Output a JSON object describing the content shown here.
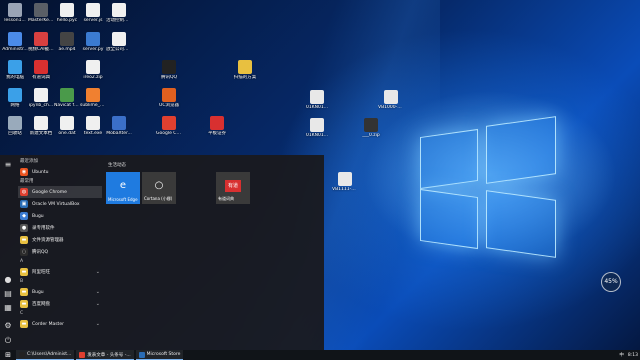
{
  "desktop_icons": [
    {
      "label": "lesson1...",
      "color": "#9aa4b5",
      "icon": "file-icon"
    },
    {
      "label": "MasterKeys Pro S",
      "color": "#5a5f66",
      "icon": "app-icon"
    },
    {
      "label": "hello.pyc",
      "color": "#f0f0f0",
      "icon": "file-icon"
    },
    {
      "label": "server.js",
      "color": "#f0f0f0",
      "icon": "file-icon"
    },
    {
      "label": "活动控制多部件操作的",
      "color": "#f0f0f0",
      "icon": "file-icon"
    },
    {
      "label": "Administr...",
      "color": "#4b8be8",
      "icon": "user-icon"
    },
    {
      "label": "视频CAI截图.exe",
      "color": "#d84040",
      "icon": "app-icon"
    },
    {
      "label": "ae.mp4",
      "color": "#444",
      "icon": "video-icon"
    },
    {
      "label": "server.py",
      "color": "#3b7bd1",
      "icon": "file-icon"
    },
    {
      "label": "放全公司总体.txt",
      "color": "#f0f0f0",
      "icon": "file-icon"
    },
    {
      "label": "我的电脑",
      "color": "#3ba0e8",
      "icon": "computer-icon"
    },
    {
      "label": "有道词典",
      "color": "#d83030",
      "icon": "app-icon"
    },
    {
      "label": "ireo2.zip",
      "color": "#f0f0f0",
      "icon": "zip-icon"
    },
    {
      "label": "腾讯QQ",
      "color": "#222",
      "icon": "qq-icon"
    },
    {
      "label": "扫描的方案",
      "color": "#e8c040",
      "icon": "folder-icon"
    },
    {
      "label": "网络",
      "color": "#3ba0e8",
      "icon": "network-icon"
    },
    {
      "label": "ipynb_ch...",
      "color": "#f0f0f0",
      "icon": "file-icon"
    },
    {
      "label": "Navicat for MySQL",
      "color": "#4a9a4a",
      "icon": "app-icon"
    },
    {
      "label": "sublime_te...",
      "color": "#f08030",
      "icon": "app-icon"
    },
    {
      "label": "UC浏览器",
      "color": "#e06020",
      "icon": "browser-icon"
    },
    {
      "label": "回收站",
      "color": "#9ab",
      "icon": "recycle-bin-icon"
    },
    {
      "label": "新建文本档",
      "color": "#f0f0f0",
      "icon": "file-icon"
    },
    {
      "label": "one.dat",
      "color": "#f0f0f0",
      "icon": "file-icon"
    },
    {
      "label": "text.exe",
      "color": "#f0f0f0",
      "icon": "file-icon"
    },
    {
      "label": "MobaXter...",
      "color": "#3b6fc8",
      "icon": "app-icon"
    },
    {
      "label": "Google Chrome",
      "color": "#e04030",
      "icon": "chrome-icon"
    },
    {
      "label": "平板证券",
      "color": "#d83030",
      "icon": "app-icon"
    },
    {
      "label": "01KN01...",
      "color": "#e8e8e8",
      "icon": "file-icon"
    },
    {
      "label": "VB1000-5...",
      "color": "#e8e8e8",
      "icon": "file-icon"
    },
    {
      "label": "01KN01...",
      "color": "#e8e8e8",
      "icon": "file-icon"
    },
    {
      "label": "___0.zip",
      "color": "#333",
      "icon": "zip-icon"
    },
    {
      "label": "VB1111-1...",
      "color": "#e8e8e8",
      "icon": "file-icon"
    }
  ],
  "start_menu": {
    "sections": [
      {
        "title": "最近添加",
        "apps": [
          {
            "label": "Ubuntu",
            "color": "#e95420",
            "glyph": "◉"
          }
        ]
      },
      {
        "title": "最常用",
        "apps": [
          {
            "label": "Google Chrome",
            "color": "#e04030",
            "glyph": "◍",
            "selected": true
          },
          {
            "label": "Oracle VM VirtualBox",
            "color": "#2a6db5",
            "glyph": "▣"
          },
          {
            "label": "Bugu",
            "color": "#3b7bd1",
            "glyph": "◆"
          },
          {
            "label": "录专用软件",
            "color": "#555",
            "glyph": "●"
          },
          {
            "label": "文件资源管理器",
            "color": "#e8c040",
            "glyph": "▬"
          },
          {
            "label": "腾讯QQ",
            "color": "#2b2b2b",
            "glyph": "◌"
          }
        ]
      },
      {
        "title": "A",
        "apps": [
          {
            "label": "阿里旺旺",
            "color": "#e8c040",
            "glyph": "▬",
            "expand": true
          }
        ]
      },
      {
        "title": "B",
        "apps": [
          {
            "label": "Bugu",
            "color": "#e8c040",
            "glyph": "▬",
            "expand": true
          },
          {
            "label": "百度网盘",
            "color": "#e8c040",
            "glyph": "▬",
            "expand": true
          }
        ]
      },
      {
        "title": "C",
        "apps": [
          {
            "label": "Corder Master",
            "color": "#e8c040",
            "glyph": "▬",
            "expand": true
          }
        ]
      }
    ],
    "tiles_header": "生活动态",
    "tiles": [
      {
        "label": "Microsoft Edge",
        "color": "#1f7be0",
        "glyph": "e"
      },
      {
        "label": "Cortana (小娜)",
        "color": "#3a3a3a",
        "glyph": "○"
      },
      {
        "label": "有道词典",
        "color": "#3a3a3a",
        "glyph": "有道"
      }
    ],
    "rail_icons": [
      "menu-icon",
      "user-icon",
      "document-icon",
      "pictures-icon",
      "settings-icon",
      "power-icon"
    ]
  },
  "taskbar": {
    "start_glyph": "⊞",
    "tasks": [
      {
        "label": "C:\\Users\\Administ...",
        "color": "#222"
      },
      {
        "label": "发表文章 - 头条号 -...",
        "color": "#e04030"
      },
      {
        "label": "Microsoft Store",
        "color": "#2a6db5"
      }
    ],
    "tray": {
      "status": "中",
      "time": "8:13"
    }
  },
  "badge": {
    "value": "45%"
  }
}
